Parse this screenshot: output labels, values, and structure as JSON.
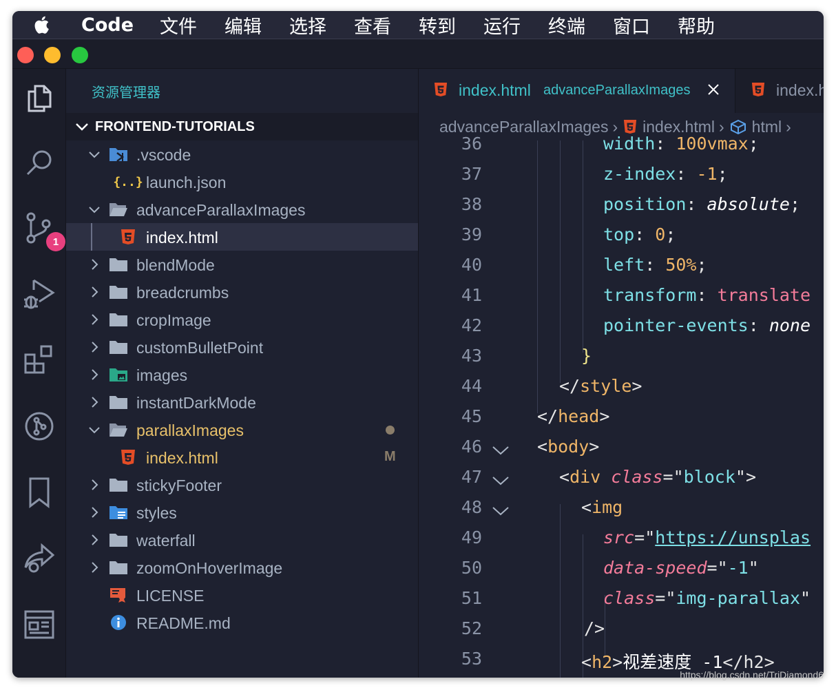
{
  "menubar": {
    "app": "Code",
    "items": [
      "文件",
      "编辑",
      "选择",
      "查看",
      "转到",
      "运行",
      "终端",
      "窗口",
      "帮助"
    ]
  },
  "activitybar": {
    "icons": [
      "explorer-icon",
      "search-icon",
      "source-control-icon",
      "run-debug-icon",
      "extensions-icon",
      "git-graph-icon",
      "bookmarks-icon",
      "live-share-icon",
      "browser-preview-icon"
    ],
    "source_control_badge": "1"
  },
  "sidebar": {
    "title": "资源管理器",
    "section": "FRONTEND-TUTORIALS",
    "tree": [
      {
        "label": ".vscode",
        "type": "folder-vscode",
        "level": 0,
        "chevron": "down"
      },
      {
        "label": "launch.json",
        "type": "json",
        "level": 1
      },
      {
        "label": "advanceParallaxImages",
        "type": "folder-open",
        "level": 0,
        "chevron": "down"
      },
      {
        "label": "index.html",
        "type": "html",
        "level": 1,
        "selected": true
      },
      {
        "label": "blendMode",
        "type": "folder",
        "level": 0,
        "chevron": "right"
      },
      {
        "label": "breadcrumbs",
        "type": "folder",
        "level": 0,
        "chevron": "right"
      },
      {
        "label": "cropImage",
        "type": "folder",
        "level": 0,
        "chevron": "right"
      },
      {
        "label": "customBulletPoint",
        "type": "folder",
        "level": 0,
        "chevron": "right"
      },
      {
        "label": "images",
        "type": "folder-images",
        "level": 0,
        "chevron": "right"
      },
      {
        "label": "instantDarkMode",
        "type": "folder",
        "level": 0,
        "chevron": "right"
      },
      {
        "label": "parallaxImages",
        "type": "folder-open",
        "level": 0,
        "chevron": "down",
        "modified": true,
        "dot": true
      },
      {
        "label": "index.html",
        "type": "html",
        "level": 1,
        "modified": true,
        "status": "M"
      },
      {
        "label": "stickyFooter",
        "type": "folder",
        "level": 0,
        "chevron": "right"
      },
      {
        "label": "styles",
        "type": "folder-styles",
        "level": 0,
        "chevron": "right"
      },
      {
        "label": "waterfall",
        "type": "folder",
        "level": 0,
        "chevron": "right"
      },
      {
        "label": "zoomOnHoverImage",
        "type": "folder",
        "level": 0,
        "chevron": "right"
      },
      {
        "label": "LICENSE",
        "type": "license",
        "level": 0
      },
      {
        "label": "README.md",
        "type": "info",
        "level": 0
      }
    ]
  },
  "editor": {
    "tabs": [
      {
        "name": "index.html",
        "description": "advanceParallaxImages",
        "active": true
      },
      {
        "name": "index.h",
        "description": "",
        "active": false
      }
    ],
    "breadcrumb": [
      "advanceParallaxImages",
      "index.html",
      "html"
    ],
    "lines": [
      {
        "n": "36"
      },
      {
        "n": "37"
      },
      {
        "n": "38"
      },
      {
        "n": "39"
      },
      {
        "n": "40"
      },
      {
        "n": "41"
      },
      {
        "n": "42"
      },
      {
        "n": "43"
      },
      {
        "n": "44"
      },
      {
        "n": "45"
      },
      {
        "n": "46"
      },
      {
        "n": "47"
      },
      {
        "n": "48"
      },
      {
        "n": "49"
      },
      {
        "n": "50"
      },
      {
        "n": "51"
      },
      {
        "n": "52"
      },
      {
        "n": "53"
      }
    ],
    "code": {
      "l36": {
        "prop": "width",
        "val": "100vmax"
      },
      "l37": {
        "prop": "z-index",
        "val": "-1"
      },
      "l38": {
        "prop": "position",
        "val": "absolute"
      },
      "l39": {
        "prop": "top",
        "val": "0"
      },
      "l40": {
        "prop": "left",
        "val": "50%"
      },
      "l41": {
        "prop": "transform",
        "val": "translate"
      },
      "l42": {
        "prop": "pointer-events",
        "val": "none"
      },
      "l43": {
        "text": "}"
      },
      "l44": {
        "tag": "style"
      },
      "l45": {
        "tag": "head"
      },
      "l46": {
        "tag": "body"
      },
      "l47": {
        "tag": "div",
        "attr": "class",
        "val": "block"
      },
      "l48": {
        "tag": "img"
      },
      "l49": {
        "attr": "src",
        "val": "https://unsplas"
      },
      "l50": {
        "attr": "data-speed",
        "val": "-1"
      },
      "l51": {
        "attr": "class",
        "val": "img-parallax"
      },
      "l52": {
        "text": "/>"
      },
      "l53": {
        "tag": "h2",
        "text": "视差速度 -1"
      }
    }
  },
  "watermark": "https://blog.csdn.net/TriDiamond6"
}
